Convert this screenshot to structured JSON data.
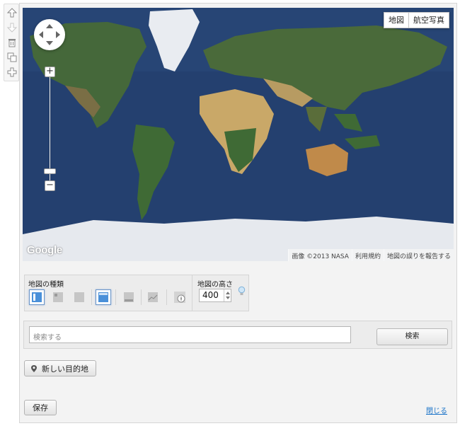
{
  "toolbar": {
    "icons": [
      "arrow-up-icon",
      "arrow-down-icon",
      "trash-icon",
      "duplicate-icon",
      "add-icon"
    ]
  },
  "map": {
    "type_buttons": {
      "map": "地図",
      "satellite": "航空写真"
    },
    "logo": "Google",
    "attribution": {
      "imagery": "画像 ©2013 NASA",
      "terms": "利用規約",
      "report": "地図の誤りを報告する"
    },
    "colors": {
      "ocean": "#24406f",
      "land": "#45683a",
      "desert": "#c9a868",
      "ice": "#e6e9ee"
    }
  },
  "map_type": {
    "label": "地図の種類",
    "options": [
      "roadmap",
      "satellite-small",
      "satellite",
      "satellite-labels",
      "hybrid",
      "terrain",
      "streetview"
    ],
    "selected": "roadmap"
  },
  "map_height": {
    "label": "地図の高さ",
    "value": "400"
  },
  "search": {
    "placeholder": "検索する",
    "button": "検索"
  },
  "destination_button": "新しい目的地",
  "save_button": "保存",
  "close_link": "閉じる",
  "accent_color": "#1a73c8"
}
